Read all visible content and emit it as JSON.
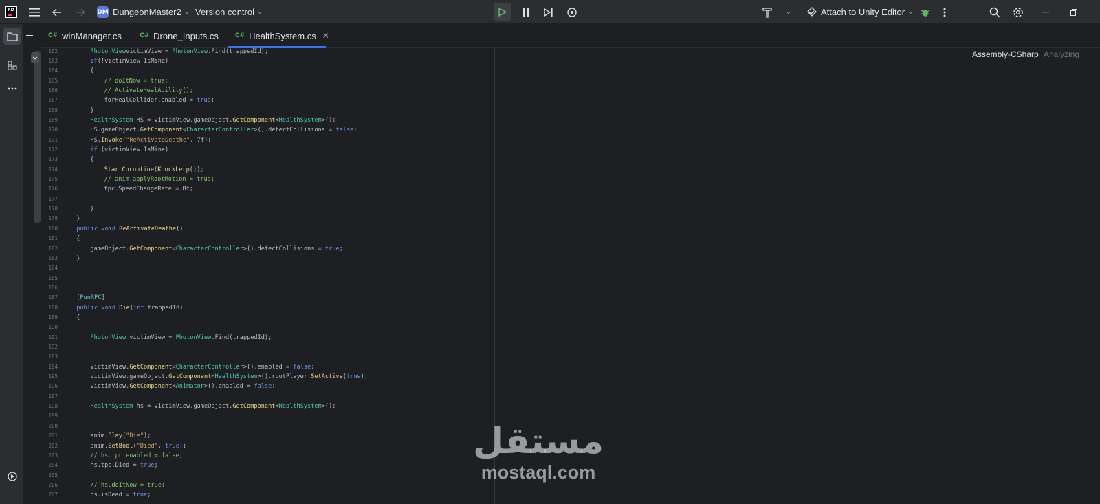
{
  "titlebar": {
    "logo_text": "RD",
    "project_badge": "DM",
    "project_name": "DungeonMaster2",
    "version_control": "Version control",
    "attach_label": "Attach to Unity Editor"
  },
  "tabs": [
    {
      "lang": "C#",
      "label": "winManager.cs"
    },
    {
      "lang": "C#",
      "label": "Drone_Inputs.cs"
    },
    {
      "lang": "C#",
      "label": "HealthSystem.cs",
      "active": true
    }
  ],
  "editor": {
    "assembly": "Assembly-CSharp",
    "status": "Analyzing",
    "lines": [
      {
        "n": "162",
        "indent": 2,
        "tokens": [
          [
            "t-type",
            "PhotonView"
          ],
          [
            "",
            "victimView = "
          ],
          [
            "t-type",
            "PhotonView"
          ],
          [
            "",
            ".Find(trappedId);"
          ]
        ]
      },
      {
        "n": "163",
        "indent": 2,
        "tokens": [
          [
            "t-kw",
            "if"
          ],
          [
            "",
            "(!victimView.IsMine)"
          ]
        ]
      },
      {
        "n": "164",
        "indent": 2,
        "tokens": [
          [
            "",
            "{"
          ]
        ]
      },
      {
        "n": "165",
        "indent": 3,
        "tokens": [
          [
            "t-cmt",
            "// doItNow = true;"
          ]
        ]
      },
      {
        "n": "166",
        "indent": 3,
        "tokens": [
          [
            "t-cmt",
            "// ActivateHealAbility();"
          ]
        ]
      },
      {
        "n": "167",
        "indent": 3,
        "tokens": [
          [
            "",
            "forHealCollider.enabled = "
          ],
          [
            "t-kw",
            "true"
          ],
          [
            "",
            ";"
          ]
        ]
      },
      {
        "n": "168",
        "indent": 2,
        "tokens": [
          [
            "",
            "}"
          ]
        ]
      },
      {
        "n": "169",
        "indent": 2,
        "tokens": [
          [
            "t-type",
            "HealthSystem"
          ],
          [
            "",
            " HS = victimView.gameObject."
          ],
          [
            "t-fn",
            "GetComponent"
          ],
          [
            "",
            "<"
          ],
          [
            "t-type",
            "HealthSystem"
          ],
          [
            "",
            ">();"
          ]
        ]
      },
      {
        "n": "170",
        "indent": 2,
        "tokens": [
          [
            "",
            "HS.gameObject."
          ],
          [
            "t-fn",
            "GetComponent"
          ],
          [
            "",
            "<"
          ],
          [
            "t-type",
            "CharacterController"
          ],
          [
            "",
            ">().detectCollisions = "
          ],
          [
            "t-kw",
            "false"
          ],
          [
            "",
            ";"
          ]
        ]
      },
      {
        "n": "171",
        "indent": 2,
        "tokens": [
          [
            "",
            "HS."
          ],
          [
            "t-fn",
            "Invoke"
          ],
          [
            "",
            "("
          ],
          [
            "t-str",
            "\"ReActivateDeathe\""
          ],
          [
            "",
            ", 7f);"
          ]
        ]
      },
      {
        "n": "172",
        "indent": 2,
        "tokens": [
          [
            "t-kw",
            "if"
          ],
          [
            "",
            " (victimView.IsMine)"
          ]
        ]
      },
      {
        "n": "173",
        "indent": 2,
        "tokens": [
          [
            "",
            "{"
          ]
        ]
      },
      {
        "n": "174",
        "indent": 3,
        "tokens": [
          [
            "t-fn",
            "StartCoroutine"
          ],
          [
            "",
            "("
          ],
          [
            "t-fn",
            "KnockLerp"
          ],
          [
            "",
            "());"
          ]
        ]
      },
      {
        "n": "175",
        "indent": 3,
        "tokens": [
          [
            "t-cmt",
            "// anim.applyRootMotion = true;"
          ]
        ]
      },
      {
        "n": "176",
        "indent": 3,
        "tokens": [
          [
            "",
            "tpc.SpeedChangeRate = 8f;"
          ]
        ]
      },
      {
        "n": "177",
        "indent": 0,
        "tokens": []
      },
      {
        "n": "178",
        "indent": 2,
        "tokens": [
          [
            "",
            "}"
          ]
        ]
      },
      {
        "n": "179",
        "indent": 1,
        "tokens": [
          [
            "",
            "}"
          ]
        ]
      },
      {
        "n": "180",
        "indent": 1,
        "tokens": [
          [
            "t-kw",
            "public void"
          ],
          [
            " ",
            ""
          ],
          [
            "t-fn",
            "ReActivateDeathe"
          ],
          [
            "",
            "()"
          ]
        ]
      },
      {
        "n": "181",
        "indent": 1,
        "tokens": [
          [
            "",
            "{"
          ]
        ]
      },
      {
        "n": "182",
        "indent": 2,
        "tokens": [
          [
            "",
            "gameObject."
          ],
          [
            "t-fn",
            "GetComponent"
          ],
          [
            "",
            "<"
          ],
          [
            "t-type",
            "CharacterController"
          ],
          [
            "",
            ">().detectCollisions = "
          ],
          [
            "t-kw",
            "true"
          ],
          [
            "",
            ";"
          ]
        ]
      },
      {
        "n": "183",
        "indent": 1,
        "tokens": [
          [
            "",
            "}"
          ]
        ]
      },
      {
        "n": "184",
        "indent": 0,
        "tokens": []
      },
      {
        "n": "185",
        "indent": 0,
        "tokens": []
      },
      {
        "n": "186",
        "indent": 0,
        "tokens": []
      },
      {
        "n": "187",
        "indent": 1,
        "tokens": [
          [
            "",
            "["
          ],
          [
            "t-attr",
            "PunRPC"
          ],
          [
            "",
            "]"
          ]
        ]
      },
      {
        "n": "188",
        "indent": 1,
        "tokens": [
          [
            "t-kw",
            "public void"
          ],
          [
            " ",
            ""
          ],
          [
            "t-fn",
            "Die"
          ],
          [
            "",
            "("
          ],
          [
            "t-kw",
            "int"
          ],
          [
            "",
            " trappedId)"
          ]
        ]
      },
      {
        "n": "189",
        "indent": 1,
        "tokens": [
          [
            "",
            "{"
          ]
        ]
      },
      {
        "n": "190",
        "indent": 0,
        "tokens": []
      },
      {
        "n": "191",
        "indent": 2,
        "tokens": [
          [
            "t-type",
            "PhotonView"
          ],
          [
            "",
            " victimView = "
          ],
          [
            "t-type",
            "PhotonView"
          ],
          [
            "",
            ".Find(trappedId);"
          ]
        ]
      },
      {
        "n": "192",
        "indent": 0,
        "tokens": []
      },
      {
        "n": "193",
        "indent": 0,
        "tokens": []
      },
      {
        "n": "194",
        "indent": 2,
        "tokens": [
          [
            "",
            "victimView."
          ],
          [
            "t-fn",
            "GetComponent"
          ],
          [
            "",
            "<"
          ],
          [
            "t-type",
            "CharacterController"
          ],
          [
            "",
            ">().enabled = "
          ],
          [
            "t-kw",
            "false"
          ],
          [
            "",
            ";"
          ]
        ]
      },
      {
        "n": "195",
        "indent": 2,
        "tokens": [
          [
            "",
            "victimView.gameObject."
          ],
          [
            "t-fn",
            "GetComponent"
          ],
          [
            "",
            "<"
          ],
          [
            "t-type",
            "HealthSystem"
          ],
          [
            "",
            ">().rootPlayer."
          ],
          [
            "t-fn",
            "SetActive"
          ],
          [
            "",
            "("
          ],
          [
            "t-kw",
            "true"
          ],
          [
            "",
            ");"
          ]
        ]
      },
      {
        "n": "196",
        "indent": 2,
        "tokens": [
          [
            "",
            "victimView."
          ],
          [
            "t-fn",
            "GetComponent"
          ],
          [
            "",
            "<"
          ],
          [
            "t-type",
            "Animator"
          ],
          [
            "",
            ">().enabled = "
          ],
          [
            "t-kw",
            "false"
          ],
          [
            "",
            ";"
          ]
        ]
      },
      {
        "n": "197",
        "indent": 0,
        "tokens": []
      },
      {
        "n": "198",
        "indent": 2,
        "tokens": [
          [
            "t-type",
            "HealthSystem"
          ],
          [
            "",
            " hs = victimView.gameObject."
          ],
          [
            "t-fn",
            "GetComponent"
          ],
          [
            "",
            "<"
          ],
          [
            "t-type",
            "HealthSystem"
          ],
          [
            "",
            ">();"
          ]
        ]
      },
      {
        "n": "199",
        "indent": 0,
        "tokens": []
      },
      {
        "n": "200",
        "indent": 0,
        "tokens": []
      },
      {
        "n": "201",
        "indent": 2,
        "tokens": [
          [
            "",
            "anim."
          ],
          [
            "t-fn",
            "Play"
          ],
          [
            "",
            "("
          ],
          [
            "t-str",
            "\"Die\""
          ],
          [
            "",
            ");"
          ]
        ]
      },
      {
        "n": "202",
        "indent": 2,
        "tokens": [
          [
            "",
            "anim."
          ],
          [
            "t-fn",
            "SetBool"
          ],
          [
            "",
            "("
          ],
          [
            "t-str",
            "\"Died\""
          ],
          [
            "",
            ", "
          ],
          [
            "t-kw",
            "true"
          ],
          [
            "",
            ");"
          ]
        ]
      },
      {
        "n": "203",
        "indent": 2,
        "tokens": [
          [
            "t-cmt",
            "// hs.tpc.enabled = false;"
          ]
        ]
      },
      {
        "n": "204",
        "indent": 2,
        "tokens": [
          [
            "",
            "hs.tpc.Died = "
          ],
          [
            "t-kw",
            "true"
          ],
          [
            "",
            ";"
          ]
        ]
      },
      {
        "n": "205",
        "indent": 0,
        "tokens": []
      },
      {
        "n": "206",
        "indent": 2,
        "tokens": [
          [
            "t-cmt",
            "// hs.doItNow = true;"
          ]
        ]
      },
      {
        "n": "207",
        "indent": 2,
        "tokens": [
          [
            "",
            "hs.isDead = "
          ],
          [
            "t-kw",
            "true"
          ],
          [
            "",
            ";"
          ]
        ]
      }
    ]
  },
  "watermark": {
    "arabic": "مستقل",
    "latin": "mostaql.com"
  }
}
